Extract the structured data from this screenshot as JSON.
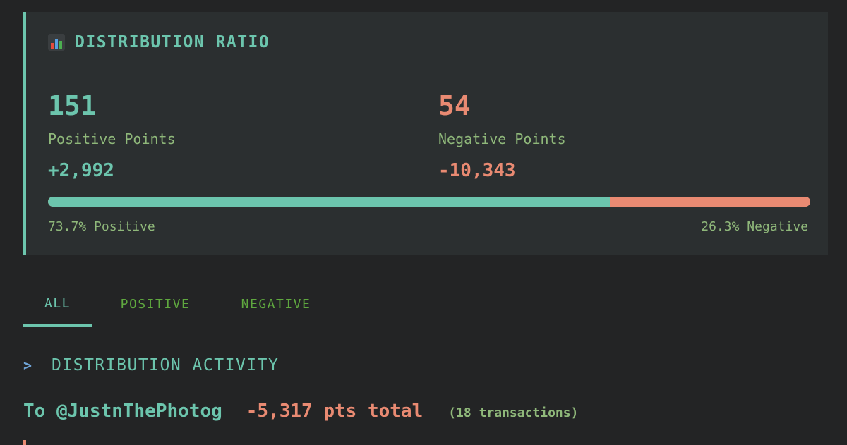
{
  "ratio_card": {
    "icon": "bar-chart-icon",
    "title": "DISTRIBUTION RATIO",
    "positive": {
      "count": "151",
      "label": "Positive Points",
      "sum": "+2,992",
      "color": "#6cc5ad"
    },
    "negative": {
      "count": "54",
      "label": "Negative Points",
      "sum": "-10,343",
      "color": "#e98a72"
    },
    "ratio": {
      "positive_percent": 73.7,
      "negative_percent": 26.3,
      "positive_label": "73.7% Positive",
      "negative_label": "26.3% Negative"
    }
  },
  "tabs": [
    {
      "label": "ALL",
      "active": true
    },
    {
      "label": "POSITIVE",
      "active": false
    },
    {
      "label": "NEGATIVE",
      "active": false
    }
  ],
  "activity": {
    "prompt": ">",
    "title": "DISTRIBUTION ACTIVITY",
    "rows": [
      {
        "recipient": "To @JustnThePhotog",
        "total": "-5,317 pts total",
        "transactions": "(18 transactions)"
      }
    ]
  },
  "colors": {
    "background": "#232425",
    "card": "#2b2f30",
    "accent": "#6cc5ad",
    "negative": "#e98a72",
    "muted_green": "#8fb87a",
    "tab_inactive": "#5fa83f",
    "prompt": "#6fa4d8"
  }
}
